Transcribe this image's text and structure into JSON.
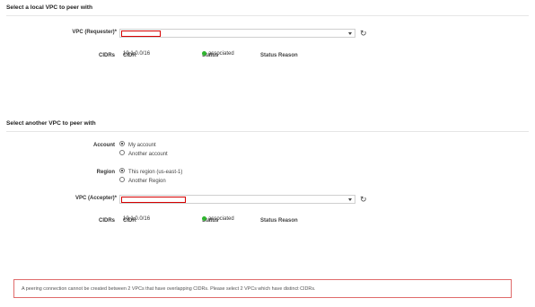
{
  "local": {
    "section_title": "Select a local VPC to peer with",
    "vpc_label": "VPC (Requester)*",
    "vpc_value": "",
    "cidrs_label": "CIDRs",
    "table": {
      "headers": [
        "CIDR",
        "Status",
        "Status Reason"
      ],
      "rows": [
        {
          "cidr": "10.1.0.0/16",
          "status": "associated",
          "reason": ""
        }
      ]
    }
  },
  "another": {
    "section_title": "Select another VPC to peer with",
    "account_label": "Account",
    "account_options": [
      "My account",
      "Another account"
    ],
    "account_selected": 0,
    "region_label": "Region",
    "region_options": [
      "This region (us-east-1)",
      "Another Region"
    ],
    "region_selected": 0,
    "vpc_label": "VPC (Accepter)*",
    "vpc_value": "",
    "cidrs_label": "CIDRs",
    "table": {
      "headers": [
        "CIDR",
        "Status",
        "Status Reason"
      ],
      "rows": [
        {
          "cidr": "10.1.0.0/16",
          "status": "associated",
          "reason": ""
        }
      ]
    }
  },
  "icons": {
    "refresh": "refresh-icon",
    "dropdown": "chevron-down-icon",
    "status_ok": "green-dot-icon"
  },
  "colors": {
    "error_border": "#e06b6b",
    "highlight_box": "#d60000",
    "status_green": "#2fb52f",
    "table_header_bg": "#e9e9e9"
  },
  "error_message": "A peering connection cannot be created between 2 VPCs that have overlapping CIDRs. Please select 2 VPCs which have distinct CIDRs."
}
